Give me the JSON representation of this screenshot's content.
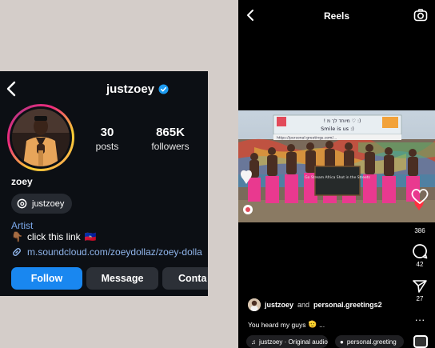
{
  "profile": {
    "handle": "justzoey",
    "name": "zoey",
    "threads_handle": "justzoey",
    "category": "Artist",
    "bio_text": "click this link",
    "bio_emoji_left": "👇🏾",
    "bio_emoji_right": "🇭🇹",
    "link": "m.soundcloud.com/zoeydollaz/zoey-dolla",
    "stats": [
      {
        "value": "30",
        "label": "posts"
      },
      {
        "value": "865K",
        "label": "followers"
      }
    ],
    "buttons": {
      "follow": "Follow",
      "message": "Message",
      "contact": "Conta"
    }
  },
  "reels": {
    "title": "Reels",
    "likes": "386",
    "comments": "42",
    "shares": "27",
    "author": "justzoey",
    "and_text": "and",
    "collaborator": "personal.greetings2",
    "caption": "You heard my guys",
    "caption_emoji": "🫡",
    "caption_more": "...",
    "audio_label": "justzoey · Original audio",
    "tag_label": "personal.greeting",
    "sign_top": "! מיוחד לך מ ♡ :)",
    "sign_smile": "Smile is us :)",
    "sign_url": "https://personal-greetings.com/...",
    "chalkboard_text": "Go Stream Africa Shot in the Streets"
  },
  "colors": {
    "accent_blue": "#1987f0",
    "link_blue": "#8fb4ea",
    "like_red": "#ff3040",
    "pants_pink": "#e9398f"
  }
}
